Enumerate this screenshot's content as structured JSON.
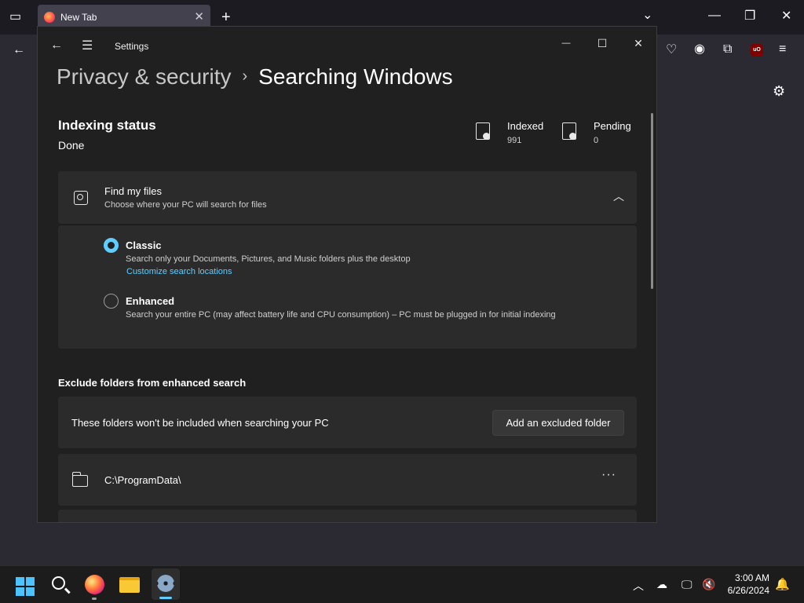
{
  "browser": {
    "tab_title": "New Tab",
    "tab_close": "✕",
    "new_tab": "+"
  },
  "window": {
    "app_title": "Settings",
    "minimize": "—",
    "maximize": "☐",
    "close": "✕"
  },
  "breadcrumb": {
    "parent": "Privacy & security",
    "separator": "›",
    "current": "Searching Windows"
  },
  "indexing": {
    "title": "Indexing status",
    "status": "Done",
    "indexed_label": "Indexed",
    "indexed_value": "991",
    "pending_label": "Pending",
    "pending_value": "0"
  },
  "find_files": {
    "title": "Find my files",
    "subtitle": "Choose where your PC will search for files",
    "options": [
      {
        "title": "Classic",
        "description": "Search only your Documents, Pictures, and Music folders plus the desktop",
        "link": "Customize search locations",
        "selected": true
      },
      {
        "title": "Enhanced",
        "description": "Search your entire PC (may affect battery life and CPU consumption) – PC must be plugged in for initial indexing",
        "selected": false
      }
    ]
  },
  "exclude": {
    "heading": "Exclude folders from enhanced search",
    "description": "These folders won't be included when searching your PC",
    "add_button": "Add an excluded folder",
    "folders": [
      "C:\\ProgramData\\"
    ],
    "more": "···"
  },
  "taskbar": {
    "time": "3:00 AM",
    "date": "6/26/2024"
  },
  "colors": {
    "accent": "#60cdff",
    "window_bg": "#202020",
    "card_bg": "#2b2b2b"
  }
}
